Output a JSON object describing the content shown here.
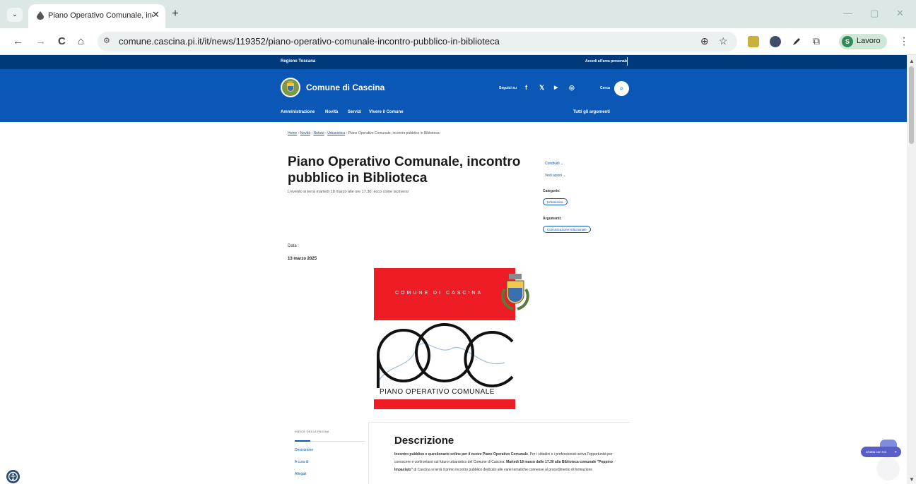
{
  "browser": {
    "tab_title": "Piano Operativo Comunale, inc",
    "tab_close": "✕",
    "new_tab": "+",
    "tab_list": "⌄",
    "url": "comune.cascina.pi.it/it/news/119352/piano-operativo-comunale-incontro-pubblico-in-biblioteca",
    "back": "←",
    "forward": "→",
    "reload": "C",
    "home": "⌂",
    "site_info": "⚙",
    "zoom": "⊕",
    "bookmark": "☆",
    "extensions": "⧉",
    "profile_initial": "S",
    "profile_label": "Lavoro",
    "menu": "⋮",
    "minimize": "—",
    "maximize": "▢",
    "close": "✕"
  },
  "site": {
    "region": "Regione Toscana",
    "personal_area": "Accedi all'area personale",
    "name": "Comune di Cascina",
    "social_label": "Seguici su",
    "social": {
      "facebook": "f",
      "x": "𝕏",
      "youtube": "▶",
      "instagram": "◎"
    },
    "search_label": "Cerca",
    "search_icon": "⌕",
    "nav": [
      "Amministrazione",
      "Novità",
      "Servizi",
      "Vivere il Comune"
    ],
    "all_topics": "Tutti gli argomenti"
  },
  "breadcrumb": {
    "items": [
      "Home",
      "Novità",
      "Notizie",
      "Urbanistica"
    ],
    "separator": "›",
    "current": "Piano Operativo Comunale, incontro pubblico in Biblioteca"
  },
  "article": {
    "title": "Piano Operativo Comunale, incontro pubblico in Biblioteca",
    "subtitle": "L'evento si terrà martedì 18 marzo alle ore 17.30: ecco come iscriversi",
    "date_label": "Data :",
    "date_value": "13 marzo 2025"
  },
  "sidebar": {
    "share": "Condividi ⌄",
    "actions": "Vedi azioni ⌄",
    "categories_label": "Categorie:",
    "category": "Urbanistica",
    "topics_label": "Argomenti:",
    "topic": "Comunicazione istituzionale"
  },
  "poster": {
    "header": "COMUNE DI CASCINA",
    "letters": "POC",
    "caption": "PIANO OPERATIVO COMUNALE"
  },
  "toc": {
    "title": "INDICE DELLA PAGINA",
    "items": [
      "Descrizione",
      "A cura di",
      "Allegati"
    ]
  },
  "description": {
    "title": "Descrizione",
    "body_bold_1": "Incontro pubblico e questionario online per il nuovo Piano Operativo Comunale",
    "body_1": ". Per i cittadini e i professionisti arriva l'opportunità per conoscere e confrontarsi sul futuro urbanistico del Comune di Cascina. ",
    "body_bold_2": "Martedì 18 marzo dalle 17.30 alla Biblioteca comunale \"Peppino Impastato\"",
    "body_2": " di Cascina si terrà il primo incontro pubblico dedicato alle varie tematiche connesse al procedimento di formazione"
  },
  "widgets": {
    "chat_label": "Chatta con noi",
    "chat_close": "✕"
  },
  "colors": {
    "header_dark": "#003a7a",
    "header": "#0b57b6",
    "poster_red": "#ee1c25",
    "chrome": "#dbe8e6"
  }
}
